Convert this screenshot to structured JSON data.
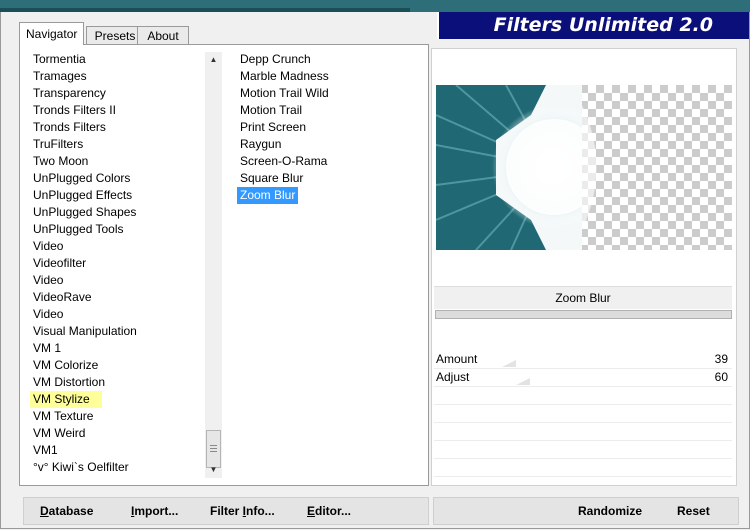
{
  "window": {
    "title": "Filters Unlimited 2.0"
  },
  "tabs": [
    {
      "label": "Navigator",
      "active": true
    },
    {
      "label": "Presets",
      "active": false
    },
    {
      "label": "About",
      "active": false
    }
  ],
  "categories": [
    "Tormentia",
    "Tramages",
    "Transparency",
    "Tronds Filters II",
    "Tronds Filters",
    "TruFilters",
    "Two Moon",
    "UnPlugged Colors",
    "UnPlugged Effects",
    "UnPlugged Shapes",
    "UnPlugged Tools",
    "Video",
    "Videofilter",
    "Video",
    "VideoRave",
    "Video",
    "Visual Manipulation",
    "VM 1",
    "VM Colorize",
    "VM Distortion",
    "VM Stylize",
    "VM Texture",
    "VM Weird",
    "VM1",
    "°v° Kiwi`s Oelfilter"
  ],
  "highlighted_category": "VM Stylize",
  "filters": [
    "Depp Crunch",
    "Marble Madness",
    "Motion Trail Wild",
    "Motion Trail",
    "Print Screen",
    "Raygun",
    "Screen-O-Rama",
    "Square Blur",
    "Zoom Blur"
  ],
  "selected_filter": "Zoom Blur",
  "preview": {
    "filter_name": "Zoom Blur",
    "accent": "#1d6470"
  },
  "params": [
    {
      "label": "Amount",
      "value": "39",
      "fraction": 0.153
    },
    {
      "label": "Adjust",
      "value": "60",
      "fraction": 0.235
    }
  ],
  "bottom_left": {
    "database": {
      "label": "Database",
      "ul": "D",
      "rest": "atabase"
    },
    "import": {
      "label": "Import...",
      "ul": "I",
      "rest": "mport..."
    },
    "filterinfo": {
      "label": "Filter Info...",
      "pre": "Filter ",
      "ul": "I",
      "rest": "nfo..."
    },
    "editor": {
      "label": "Editor...",
      "ul": "E",
      "rest": "ditor..."
    }
  },
  "bottom_right": {
    "randomize": "Randomize",
    "reset": "Reset"
  },
  "colors": {
    "banner": "#0b0f7a",
    "selection": "#3399ff",
    "highlight": "#ffff99"
  }
}
